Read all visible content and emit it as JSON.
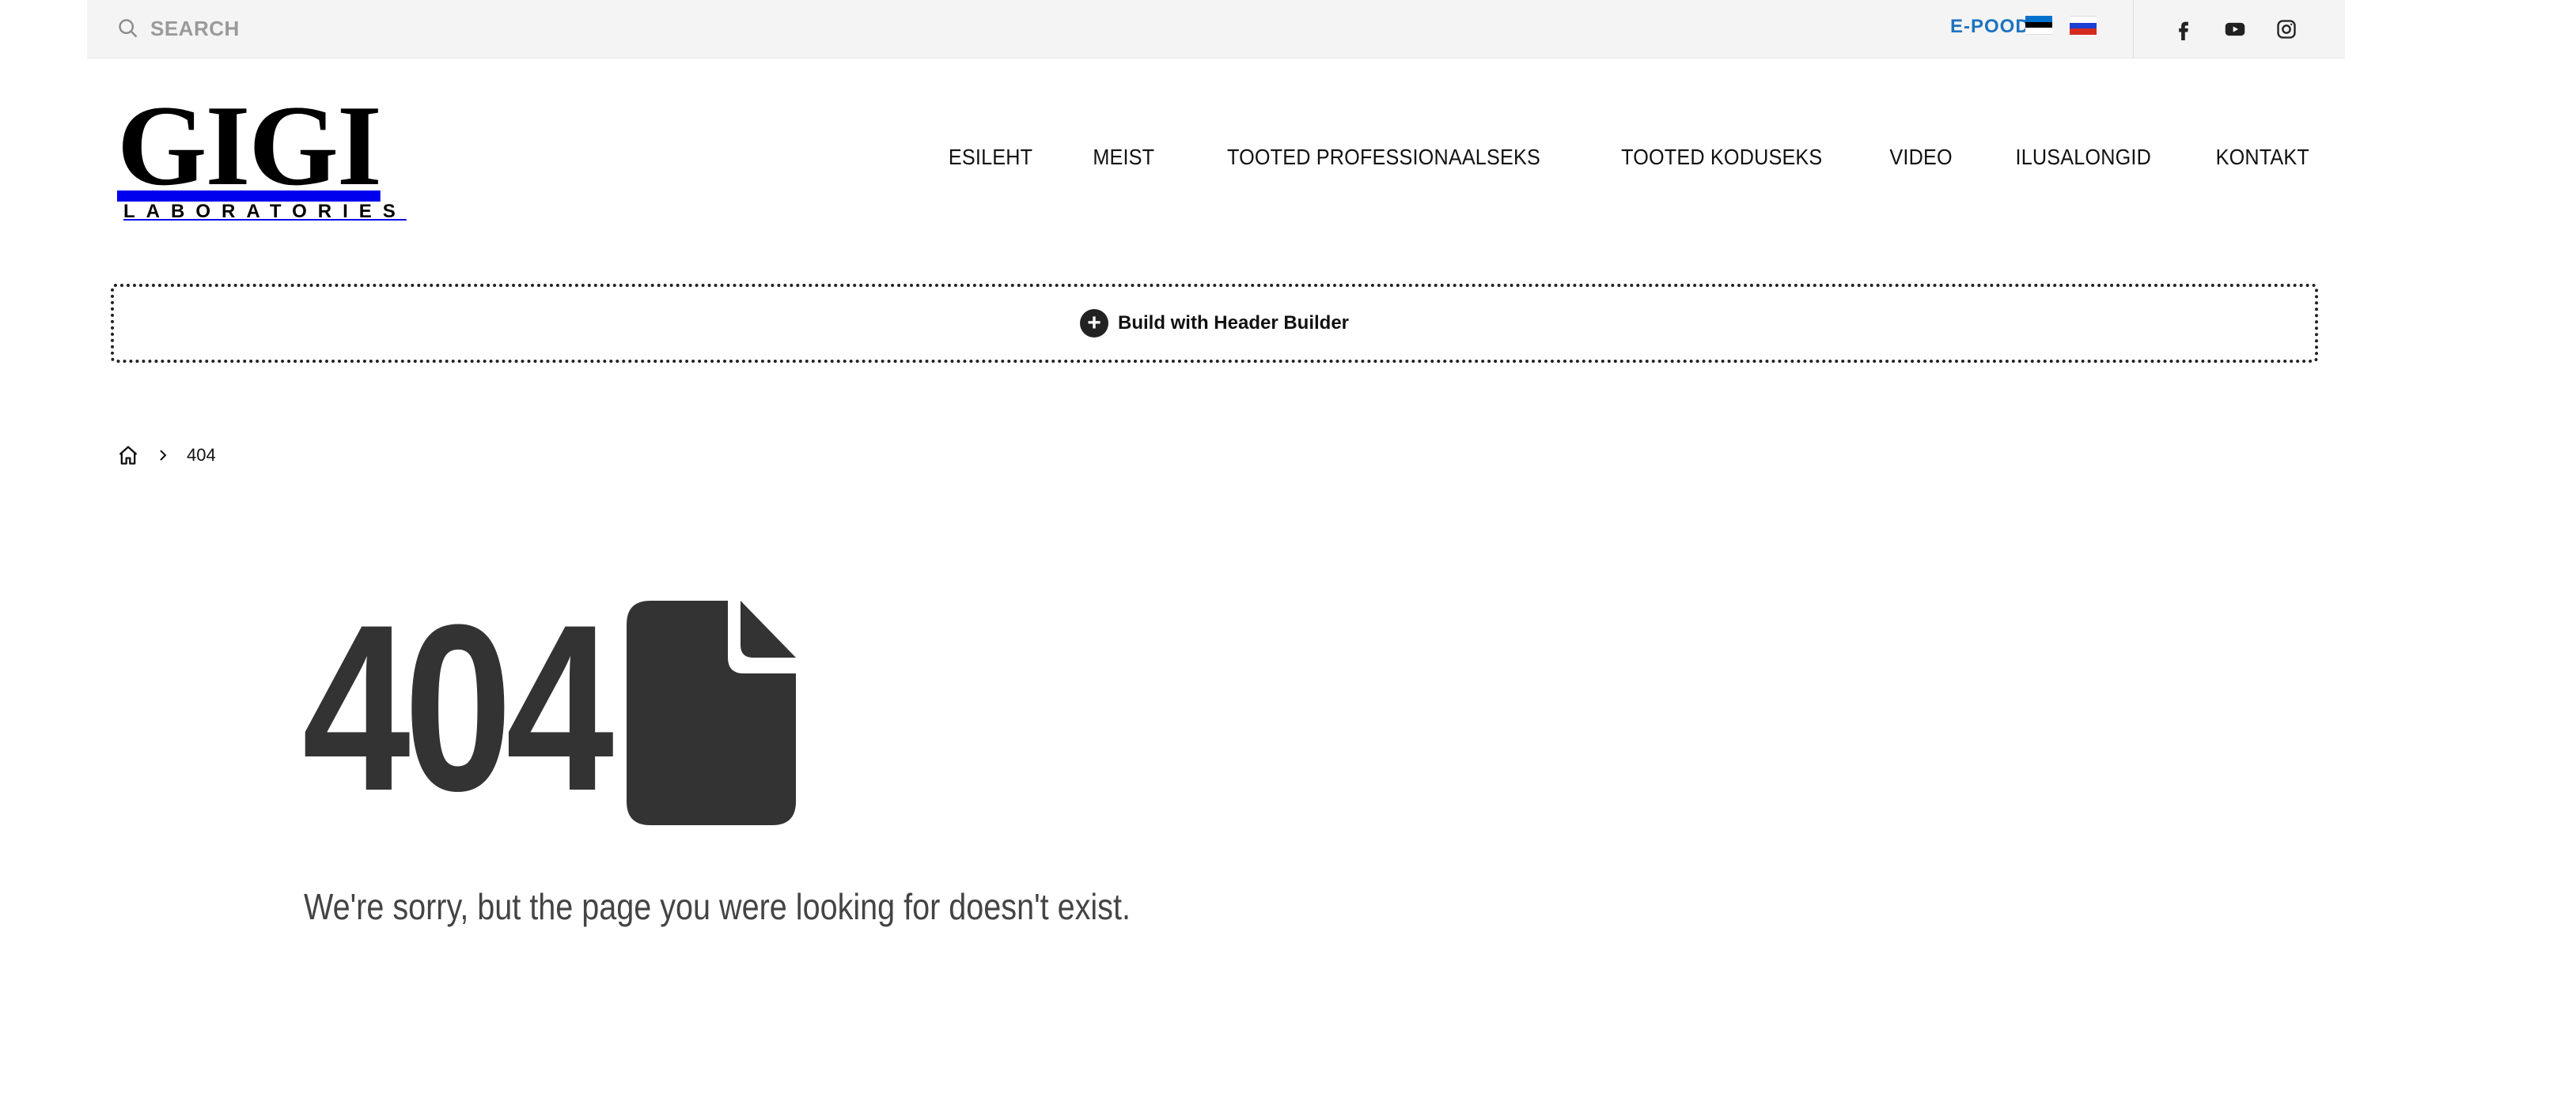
{
  "topbar": {
    "search_placeholder": "SEARCH",
    "epood_label": "E-POOD",
    "flags": [
      "estonian-flag",
      "russian-flag"
    ],
    "social": [
      "facebook-icon",
      "youtube-icon",
      "instagram-icon"
    ]
  },
  "logo": {
    "main": "GIGI",
    "sub": "LABORATORIES"
  },
  "nav": {
    "items": [
      {
        "label": "ESILEHT"
      },
      {
        "label": "MEIST"
      },
      {
        "label": "TOOTED PROFESSIONAALSEKS"
      },
      {
        "label": "TOOTED KODUSEKS"
      },
      {
        "label": "VIDEO"
      },
      {
        "label": "ILUSALONGID"
      },
      {
        "label": "KONTAKT"
      }
    ]
  },
  "builder": {
    "label": "Build with Header Builder"
  },
  "breadcrumb": {
    "current": "404"
  },
  "error": {
    "code": "404",
    "message": "We're sorry, but the page you were looking for doesn't exist."
  },
  "colors": {
    "link_blue": "#1e73be",
    "dark_gray": "#333333",
    "topbar_bg": "#f4f4f4"
  }
}
